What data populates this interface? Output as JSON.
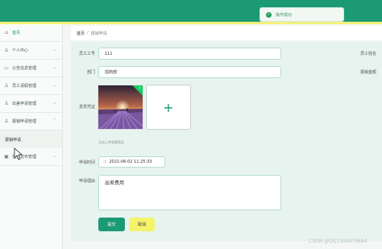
{
  "toast": {
    "text": "操作成功",
    "icon": "check-icon"
  },
  "sidebar": {
    "items": [
      {
        "label": "首页",
        "icon": "home-icon"
      },
      {
        "label": "个人中心",
        "icon": "user-icon"
      },
      {
        "label": "公告信息管理",
        "icon": "notice-icon"
      },
      {
        "label": "员工请假管理",
        "icon": "user-icon"
      },
      {
        "label": "出差申请管理",
        "icon": "user-icon"
      },
      {
        "label": "报销申请管理",
        "icon": "user-icon"
      },
      {
        "label": "任务发布管理",
        "icon": "task-icon"
      }
    ],
    "sub_item": "报销申请"
  },
  "breadcrumb": {
    "home": "首页",
    "separator": "/",
    "current": "报销申请"
  },
  "form": {
    "employee_id_label": "员工工号",
    "employee_id_value": "111",
    "employee_name_label": "员工姓名",
    "department_label": "部门",
    "department_value": "招商部",
    "amount_label": "报销金额",
    "voucher_label": "发票凭证",
    "upload_hint": "点击上传发票凭证",
    "time_label": "申请时间",
    "time_value": "2021-06-02 11:25:33",
    "reason_label": "申请理由",
    "reason_value": "出差费用",
    "submit_label": "提交",
    "cancel_label": "取消"
  },
  "watermark": "CSDN @QQ1304979694",
  "colors": {
    "brand": "#1b9a74",
    "accent_yellow": "#f4f27a",
    "success": "#13ce66"
  }
}
